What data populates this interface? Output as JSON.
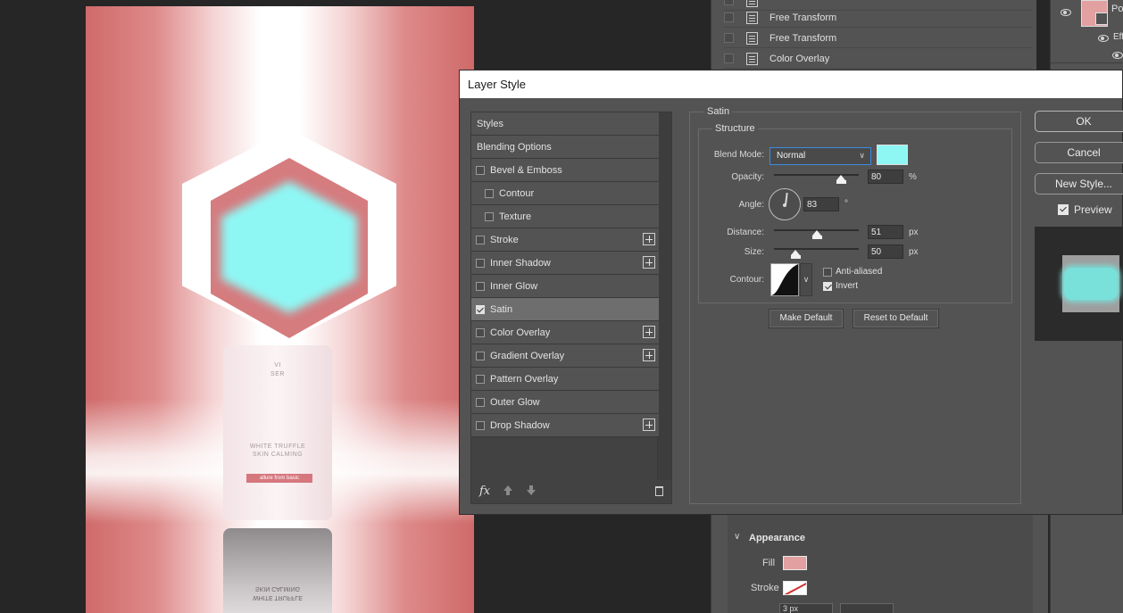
{
  "history": {
    "rows": [
      {
        "label": "Free Transform"
      },
      {
        "label": "Free Transform"
      },
      {
        "label": "Color Overlay"
      }
    ]
  },
  "layers": {
    "partial_label_1": "Po",
    "partial_label_2": "Eff"
  },
  "canvas": {
    "bottle_line1": "VI",
    "bottle_line2": "SER",
    "bottle_line3": "WHITE TRUFFLE",
    "bottle_line4": "SKIN CALMING",
    "bottle_badge": "allure from basic",
    "reflection_line1": "SKIN CALMING",
    "reflection_line2": "WHITE TRUFFLE",
    "hex_fill_color": "#8ef7f4"
  },
  "dialog": {
    "title": "Layer Style",
    "styles_list": [
      {
        "label": "Styles",
        "checkbox": false,
        "checked": false,
        "indent": false,
        "plus": false,
        "active": false
      },
      {
        "label": "Blending Options",
        "checkbox": false,
        "checked": false,
        "indent": false,
        "plus": false,
        "active": false
      },
      {
        "label": "Bevel & Emboss",
        "checkbox": true,
        "checked": false,
        "indent": false,
        "plus": false,
        "active": false
      },
      {
        "label": "Contour",
        "checkbox": true,
        "checked": false,
        "indent": true,
        "plus": false,
        "active": false
      },
      {
        "label": "Texture",
        "checkbox": true,
        "checked": false,
        "indent": true,
        "plus": false,
        "active": false
      },
      {
        "label": "Stroke",
        "checkbox": true,
        "checked": false,
        "indent": false,
        "plus": true,
        "active": false
      },
      {
        "label": "Inner Shadow",
        "checkbox": true,
        "checked": false,
        "indent": false,
        "plus": true,
        "active": false
      },
      {
        "label": "Inner Glow",
        "checkbox": true,
        "checked": false,
        "indent": false,
        "plus": false,
        "active": false
      },
      {
        "label": "Satin",
        "checkbox": true,
        "checked": true,
        "indent": false,
        "plus": false,
        "active": true
      },
      {
        "label": "Color Overlay",
        "checkbox": true,
        "checked": false,
        "indent": false,
        "plus": true,
        "active": false
      },
      {
        "label": "Gradient Overlay",
        "checkbox": true,
        "checked": false,
        "indent": false,
        "plus": true,
        "active": false
      },
      {
        "label": "Pattern Overlay",
        "checkbox": true,
        "checked": false,
        "indent": false,
        "plus": false,
        "active": false
      },
      {
        "label": "Outer Glow",
        "checkbox": true,
        "checked": false,
        "indent": false,
        "plus": false,
        "active": false
      },
      {
        "label": "Drop Shadow",
        "checkbox": true,
        "checked": false,
        "indent": false,
        "plus": true,
        "active": false
      }
    ],
    "footer": {
      "fx_label": "fx"
    },
    "satin": {
      "group_label": "Satin",
      "structure_label": "Structure",
      "blend_mode_label": "Blend Mode:",
      "blend_mode_value": "Normal",
      "color": "#8ef7f4",
      "opacity_label": "Opacity:",
      "opacity_value": "80",
      "opacity_unit": "%",
      "opacity_fraction": 0.8,
      "angle_label": "Angle:",
      "angle_value": "83",
      "angle_unit": "°",
      "distance_label": "Distance:",
      "distance_value": "51",
      "distance_unit": "px",
      "size_label": "Size:",
      "size_value": "50",
      "size_unit": "px",
      "contour_label": "Contour:",
      "anti_aliased_label": "Anti-aliased",
      "anti_aliased_checked": false,
      "invert_label": "Invert",
      "invert_checked": true,
      "make_default_label": "Make Default",
      "reset_default_label": "Reset to Default"
    },
    "buttons": {
      "ok": "OK",
      "cancel": "Cancel",
      "new_style": "New Style...",
      "preview_label": "Preview",
      "preview_checked": true
    }
  },
  "properties": {
    "section_title": "Appearance",
    "fill_label": "Fill",
    "stroke_label": "Stroke",
    "fill_color": "#e2a0a0",
    "stroke_width": "3 px"
  }
}
